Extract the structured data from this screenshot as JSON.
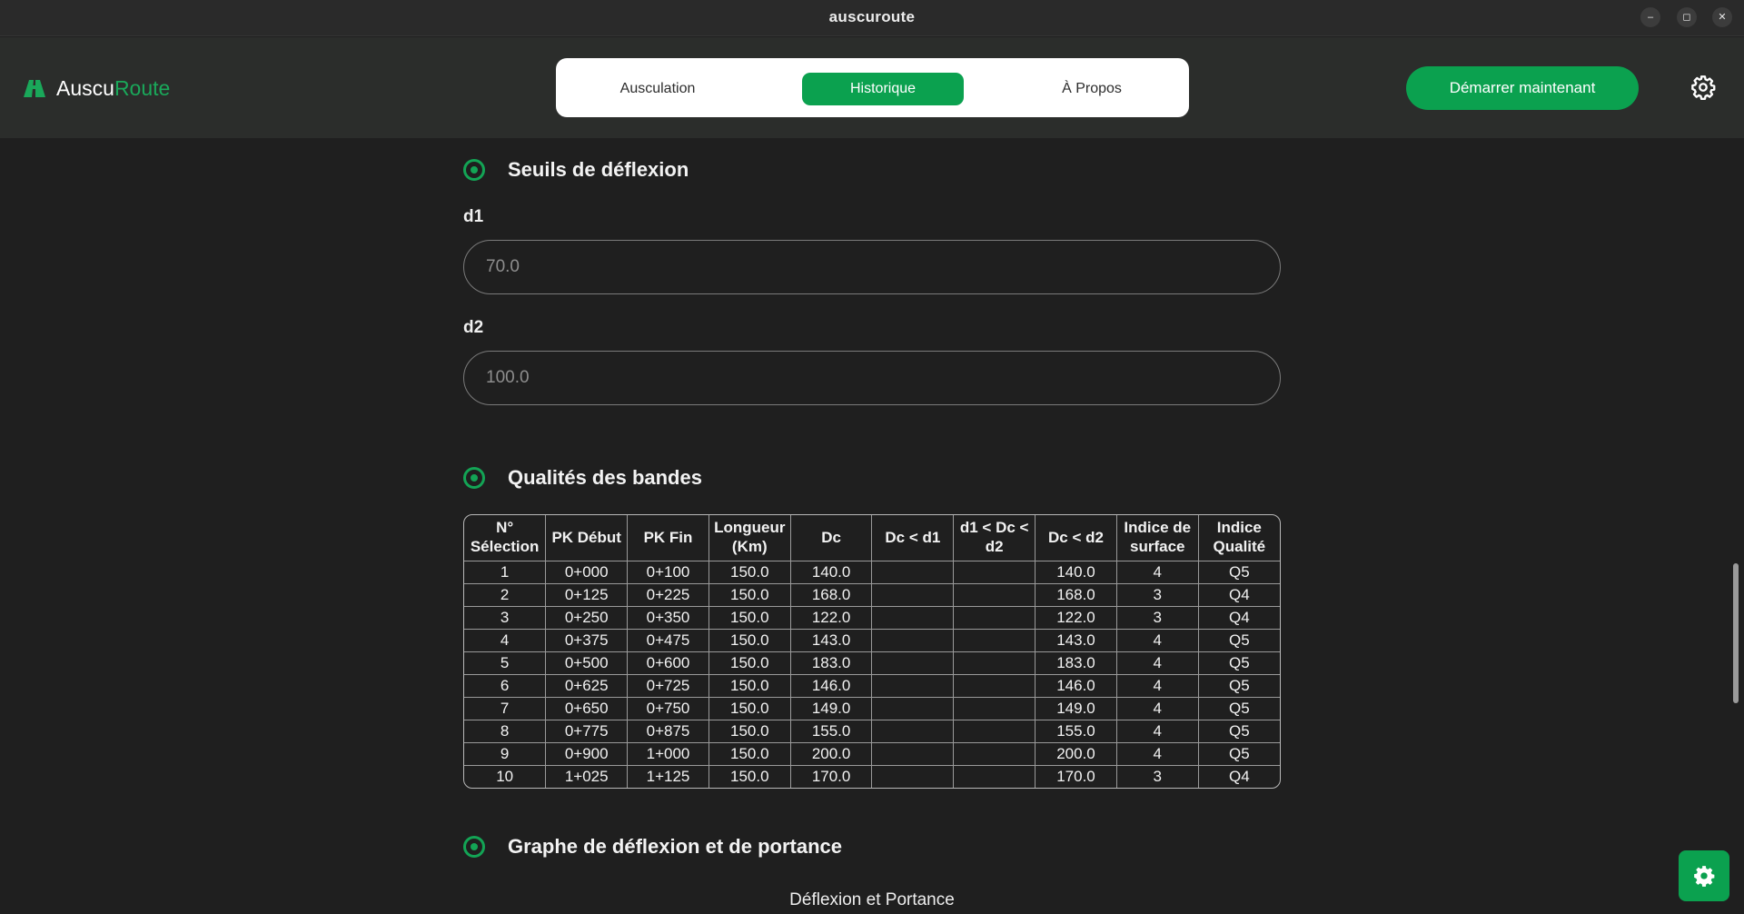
{
  "window": {
    "title": "auscuroute",
    "controls": [
      "–",
      "◻",
      "✕"
    ]
  },
  "brand": {
    "name_part1": "Auscu",
    "name_part2": "Route",
    "accent_color": "#1aa85a"
  },
  "nav": {
    "tabs": [
      {
        "label": "Ausculation",
        "active": false
      },
      {
        "label": "Historique",
        "active": true
      },
      {
        "label": "À Propos",
        "active": false
      }
    ]
  },
  "header": {
    "cta_label": "Démarrer maintenant",
    "settings_icon": "gear-icon"
  },
  "thresholds": {
    "title": "Seuils de déflexion",
    "d1": {
      "label": "d1",
      "placeholder": "70.0"
    },
    "d2": {
      "label": "d2",
      "placeholder": "100.0"
    }
  },
  "quality": {
    "title": "Qualités des bandes",
    "columns": [
      "N° Sélection",
      "PK Début",
      "PK Fin",
      "Longueur (Km)",
      "Dc",
      "Dc < d1",
      "d1 < Dc < d2",
      "Dc < d2",
      "Indice de surface",
      "Indice Qualité"
    ],
    "rows": [
      [
        "1",
        "0+000",
        "0+100",
        "150.0",
        "140.0",
        "",
        "",
        "140.0",
        "4",
        "Q5"
      ],
      [
        "2",
        "0+125",
        "0+225",
        "150.0",
        "168.0",
        "",
        "",
        "168.0",
        "3",
        "Q4"
      ],
      [
        "3",
        "0+250",
        "0+350",
        "150.0",
        "122.0",
        "",
        "",
        "122.0",
        "3",
        "Q4"
      ],
      [
        "4",
        "0+375",
        "0+475",
        "150.0",
        "143.0",
        "",
        "",
        "143.0",
        "4",
        "Q5"
      ],
      [
        "5",
        "0+500",
        "0+600",
        "150.0",
        "183.0",
        "",
        "",
        "183.0",
        "4",
        "Q5"
      ],
      [
        "6",
        "0+625",
        "0+725",
        "150.0",
        "146.0",
        "",
        "",
        "146.0",
        "4",
        "Q5"
      ],
      [
        "7",
        "0+650",
        "0+750",
        "150.0",
        "149.0",
        "",
        "",
        "149.0",
        "4",
        "Q5"
      ],
      [
        "8",
        "0+775",
        "0+875",
        "150.0",
        "155.0",
        "",
        "",
        "155.0",
        "4",
        "Q5"
      ],
      [
        "9",
        "0+900",
        "1+000",
        "150.0",
        "200.0",
        "",
        "",
        "200.0",
        "4",
        "Q5"
      ],
      [
        "10",
        "1+025",
        "1+125",
        "150.0",
        "170.0",
        "",
        "",
        "170.0",
        "3",
        "Q4"
      ]
    ]
  },
  "graph": {
    "title": "Graphe de déflexion et de portance",
    "chart_title": "Déflexion et Portance"
  },
  "colors": {
    "primary": "#0ba14f",
    "background": "#1f1f1f",
    "header_bg": "#2b2d2b"
  }
}
